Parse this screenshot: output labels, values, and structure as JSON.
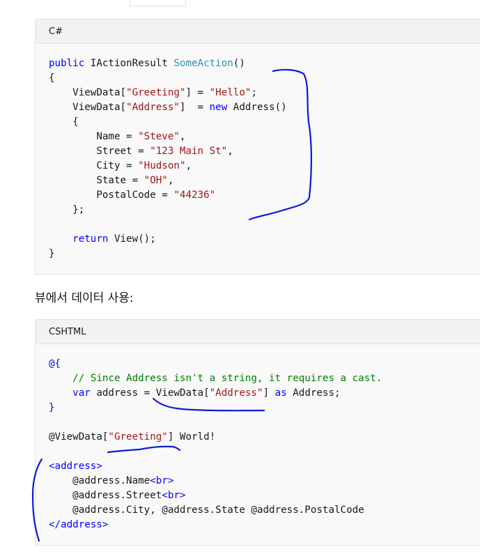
{
  "csharp_block": {
    "language": "C#",
    "lines": [
      [
        {
          "t": "public",
          "c": "kw"
        },
        {
          "t": " IActionResult "
        },
        {
          "t": "SomeAction",
          "c": "tp"
        },
        {
          "t": "()"
        }
      ],
      [
        {
          "t": "{"
        }
      ],
      [
        {
          "t": "    ViewData["
        },
        {
          "t": "\"Greeting\"",
          "c": "st"
        },
        {
          "t": "] = "
        },
        {
          "t": "\"Hello\"",
          "c": "st"
        },
        {
          "t": ";"
        }
      ],
      [
        {
          "t": "    ViewData["
        },
        {
          "t": "\"Address\"",
          "c": "st"
        },
        {
          "t": "]  = "
        },
        {
          "t": "new",
          "c": "kw"
        },
        {
          "t": " Address()"
        }
      ],
      [
        {
          "t": "    {"
        }
      ],
      [
        {
          "t": "        Name = "
        },
        {
          "t": "\"Steve\"",
          "c": "st"
        },
        {
          "t": ","
        }
      ],
      [
        {
          "t": "        Street = "
        },
        {
          "t": "\"123 Main St\"",
          "c": "st"
        },
        {
          "t": ","
        }
      ],
      [
        {
          "t": "        City = "
        },
        {
          "t": "\"Hudson\"",
          "c": "st"
        },
        {
          "t": ","
        }
      ],
      [
        {
          "t": "        State = "
        },
        {
          "t": "\"OH\"",
          "c": "st"
        },
        {
          "t": ","
        }
      ],
      [
        {
          "t": "        PostalCode = "
        },
        {
          "t": "\"44236\"",
          "c": "st"
        }
      ],
      [
        {
          "t": "    };"
        }
      ],
      [
        {
          "t": ""
        }
      ],
      [
        {
          "t": "    "
        },
        {
          "t": "return",
          "c": "kw"
        },
        {
          "t": " View();"
        }
      ],
      [
        {
          "t": "}"
        }
      ]
    ]
  },
  "section_text": "뷰에서 데이터 사용:",
  "cshtml_block": {
    "language": "CSHTML",
    "lines": [
      [
        {
          "t": "@{",
          "c": "kw"
        }
      ],
      [
        {
          "t": "    "
        },
        {
          "t": "// Since Address isn't a string, it requires a cast.",
          "c": "cm"
        }
      ],
      [
        {
          "t": "    "
        },
        {
          "t": "var",
          "c": "kw"
        },
        {
          "t": " address = ViewData["
        },
        {
          "t": "\"Address\"",
          "c": "st"
        },
        {
          "t": "] "
        },
        {
          "t": "as",
          "c": "kw"
        },
        {
          "t": " Address;"
        }
      ],
      [
        {
          "t": "}",
          "c": "kw"
        }
      ],
      [
        {
          "t": ""
        }
      ],
      [
        {
          "t": "@ViewData["
        },
        {
          "t": "\"Greeting\"",
          "c": "st"
        },
        {
          "t": "] World!"
        }
      ],
      [
        {
          "t": ""
        }
      ],
      [
        {
          "t": "<address>",
          "c": "tg"
        }
      ],
      [
        {
          "t": "    @address.Name"
        },
        {
          "t": "<br>",
          "c": "tg"
        }
      ],
      [
        {
          "t": "    @address.Street"
        },
        {
          "t": "<br>",
          "c": "tg"
        }
      ],
      [
        {
          "t": "    @address.City, @address.State @address.PostalCode"
        }
      ],
      [
        {
          "t": "</address>",
          "c": "tg"
        }
      ]
    ]
  },
  "annotation_color": "#0a1ad6"
}
